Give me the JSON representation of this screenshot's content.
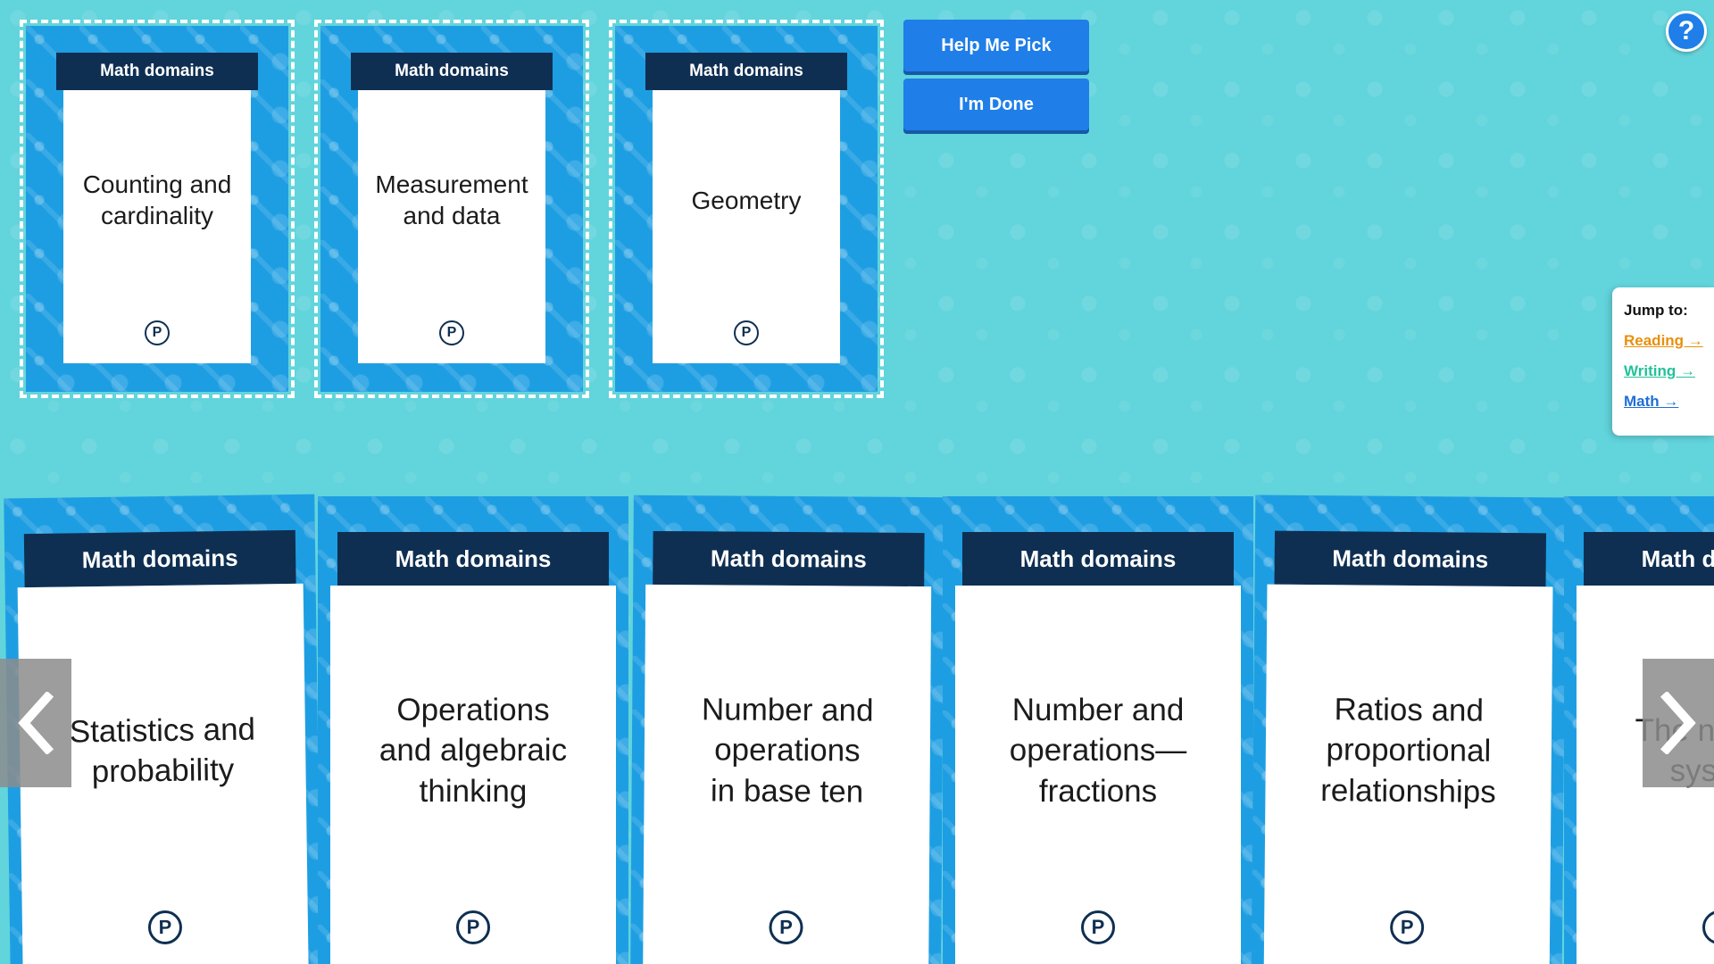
{
  "selected": [
    {
      "header": "Math domains",
      "title": "Counting and\ncardinality",
      "logo": "P"
    },
    {
      "header": "Math domains",
      "title": "Measurement\nand data",
      "logo": "P"
    },
    {
      "header": "Math domains",
      "title": "Geometry",
      "logo": "P"
    }
  ],
  "buttons": {
    "help_pick": "Help Me Pick",
    "done": "I'm Done"
  },
  "help_icon": "?",
  "jump": {
    "title": "Jump to:",
    "links": [
      {
        "label": "Reading →",
        "color": "#e8900c"
      },
      {
        "label": "Writing →",
        "color": "#22c29a"
      },
      {
        "label": "Math →",
        "color": "#1f6fd6"
      }
    ]
  },
  "cards": [
    {
      "header": "Math domains",
      "title": "Statistics and\nprobability",
      "logo": "P"
    },
    {
      "header": "Math domains",
      "title": "Operations\nand algebraic\nthinking",
      "logo": "P"
    },
    {
      "header": "Math domains",
      "title": "Number and\noperations\nin base ten",
      "logo": "P"
    },
    {
      "header": "Math domains",
      "title": "Number and\noperations—\nfractions",
      "logo": "P"
    },
    {
      "header": "Math domains",
      "title": "Ratios and\nproportional\nrelationships",
      "logo": "P"
    },
    {
      "header": "Math domains",
      "title": "The number\nsystem",
      "logo": "P"
    }
  ],
  "colors": {
    "background": "#62d4dc",
    "card_blue": "#1e9ee2",
    "banner_navy": "#0f2f52",
    "button_blue": "#1f7ee8"
  },
  "icons": {
    "prev": "chevron-left-icon",
    "next": "chevron-right-icon",
    "help": "question-mark-icon"
  }
}
